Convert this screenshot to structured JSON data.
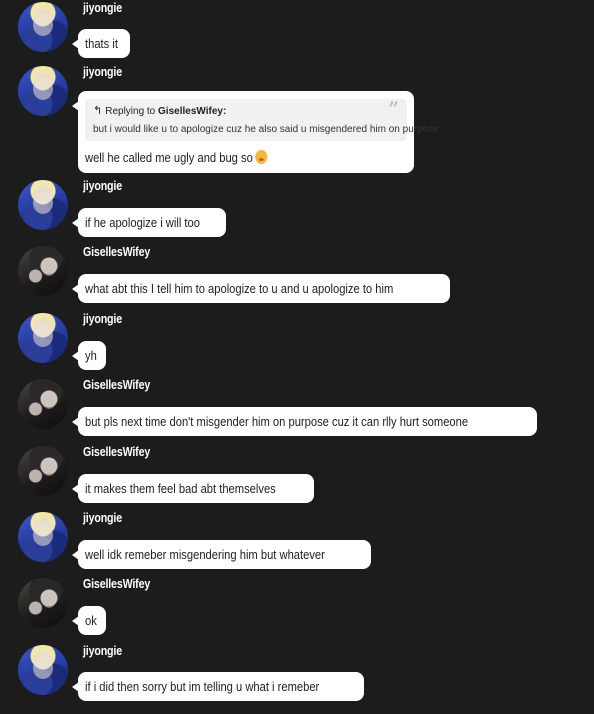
{
  "messages": [
    {
      "author": "jiyongie",
      "avatar": "jiyongie-avatar",
      "text": "thats it"
    },
    {
      "author": "jiyongie",
      "avatar": "jiyongie-avatar",
      "reply": {
        "prefix": "Replying to",
        "to": "GisellesWifey:",
        "text": "but i would like u to apologize cuz he also said u misgendered him on purpose"
      },
      "text": "well he called me ugly and bug so",
      "emoji": "face-with-hand-over-mouth"
    },
    {
      "author": "jiyongie",
      "avatar": "jiyongie-avatar",
      "text": "if he apologize i will too"
    },
    {
      "author": "GisellesWifey",
      "avatar": "gisellewifey-avatar",
      "text": "what abt this I tell him to apologize to u and u apologize to him"
    },
    {
      "author": "jiyongie",
      "avatar": "jiyongie-avatar",
      "text": "yh"
    },
    {
      "author": "GisellesWifey",
      "avatar": "gisellewifey-avatar",
      "text": "but pls next time don't misgender him on purpose cuz it can rlly hurt someone"
    },
    {
      "author": "GisellesWifey",
      "avatar": "gisellewifey-avatar",
      "text": "it makes them feel bad abt themselves"
    },
    {
      "author": "jiyongie",
      "avatar": "jiyongie-avatar",
      "text": "well idk remeber misgendering him but whatever"
    },
    {
      "author": "GisellesWifey",
      "avatar": "gisellewifey-avatar",
      "text": "ok"
    },
    {
      "author": "jiyongie",
      "avatar": "jiyongie-avatar",
      "text": "if i did then sorry but im telling u what i remeber"
    }
  ],
  "colors": {
    "background": "#1c1c1c",
    "bubble": "#ffffff",
    "author": "#ffffff"
  },
  "icons": {
    "reply": "reply-arrow-icon",
    "quote": "quote-icon"
  }
}
